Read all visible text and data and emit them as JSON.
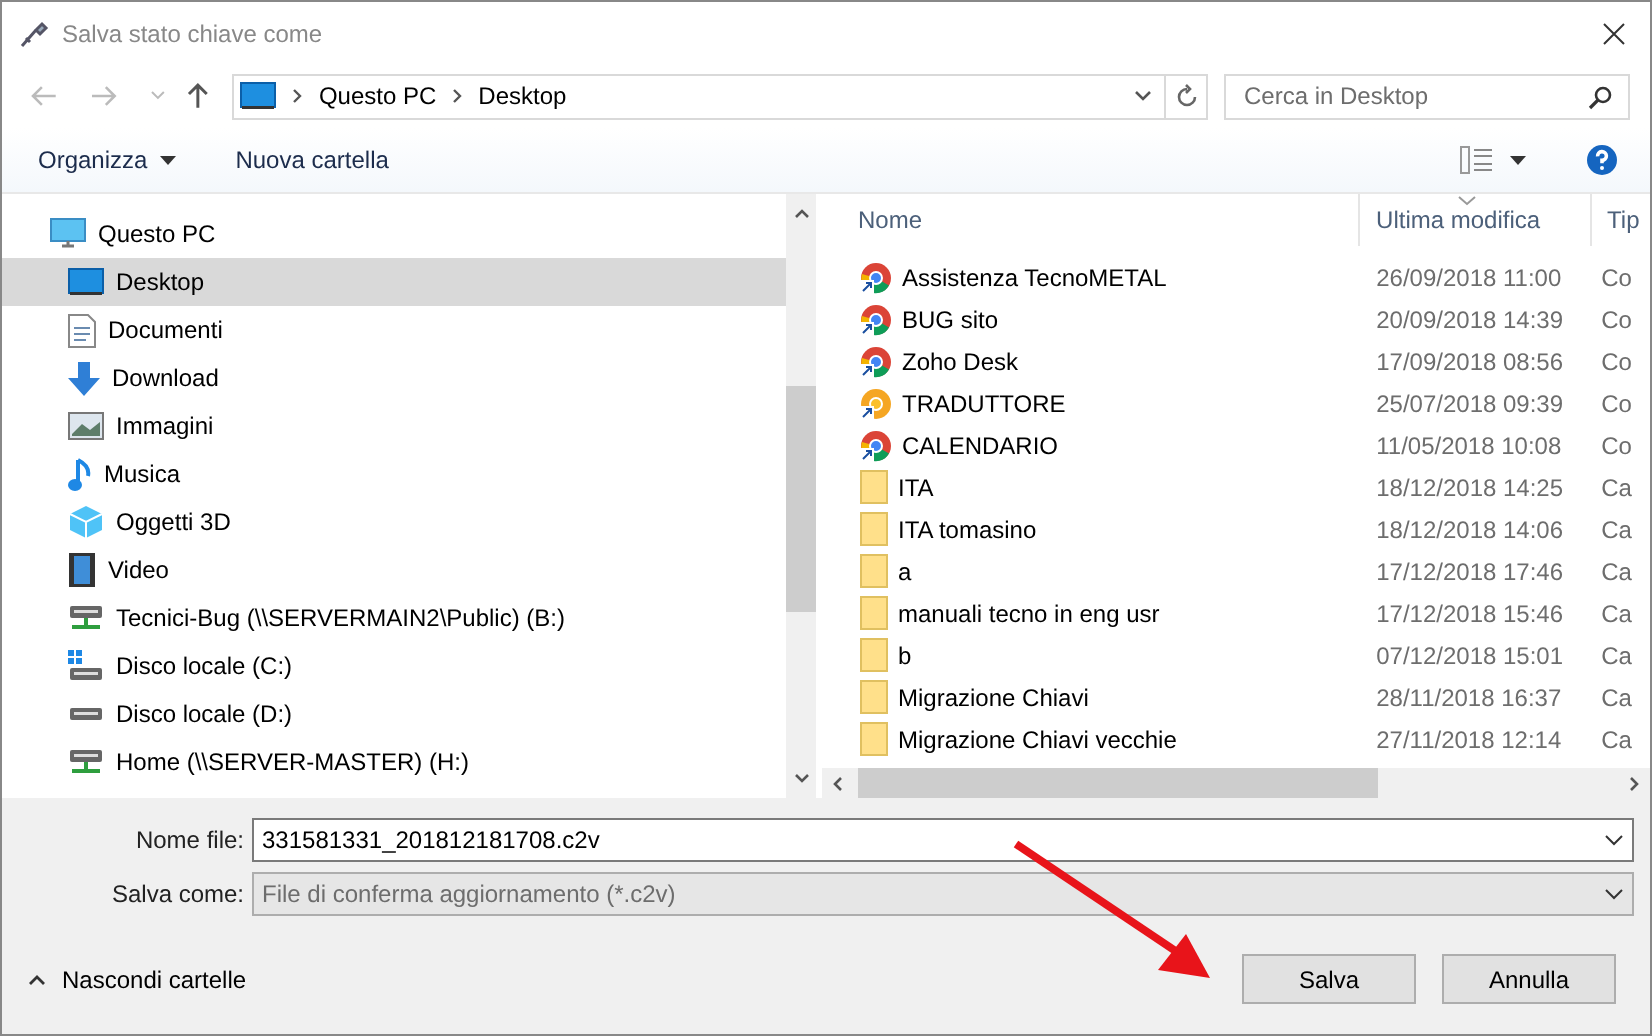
{
  "window": {
    "title": "Salva stato chiave come"
  },
  "address": {
    "crumbs": [
      "Questo PC",
      "Desktop"
    ]
  },
  "search": {
    "placeholder": "Cerca in Desktop"
  },
  "toolbar": {
    "organize": "Organizza",
    "new_folder": "Nuova cartella"
  },
  "sidebar": {
    "items": [
      {
        "label": "Questo PC",
        "kind": "pc",
        "selected": false,
        "children": [
          {
            "label": "Desktop",
            "kind": "desktop",
            "selected": true
          },
          {
            "label": "Documenti",
            "kind": "documents",
            "selected": false
          },
          {
            "label": "Download",
            "kind": "download",
            "selected": false
          },
          {
            "label": "Immagini",
            "kind": "pictures",
            "selected": false
          },
          {
            "label": "Musica",
            "kind": "music",
            "selected": false
          },
          {
            "label": "Oggetti 3D",
            "kind": "objects3d",
            "selected": false
          },
          {
            "label": "Video",
            "kind": "video",
            "selected": false
          },
          {
            "label": "Tecnici-Bug (\\\\SERVERMAIN2\\Public) (B:)",
            "kind": "netdrive",
            "selected": false
          },
          {
            "label": "Disco locale (C:)",
            "kind": "sysdrive",
            "selected": false
          },
          {
            "label": "Disco locale (D:)",
            "kind": "drive",
            "selected": false
          },
          {
            "label": "Home (\\\\SERVER-MASTER) (H:)",
            "kind": "netdrive",
            "selected": false
          }
        ]
      }
    ]
  },
  "table": {
    "columns": [
      "Nome",
      "Ultima modifica",
      "Tip"
    ],
    "rows": [
      {
        "kind": "shortcut",
        "name": "Assistenza TecnoMETAL",
        "modified": "26/09/2018 11:00",
        "column_3": "Co"
      },
      {
        "kind": "shortcut",
        "name": "BUG sito",
        "modified": "20/09/2018 14:39",
        "column_3": "Co"
      },
      {
        "kind": "shortcut",
        "name": "Zoho Desk",
        "modified": "17/09/2018 08:56",
        "column_3": "Co"
      },
      {
        "kind": "shortcut_alt",
        "name": "TRADUTTORE",
        "modified": "25/07/2018 09:39",
        "column_3": "Co"
      },
      {
        "kind": "shortcut",
        "name": "CALENDARIO",
        "modified": "11/05/2018 10:08",
        "column_3": "Co"
      },
      {
        "kind": "folder",
        "name": "ITA",
        "modified": "18/12/2018 14:25",
        "column_3": "Ca"
      },
      {
        "kind": "folder",
        "name": "ITA tomasino",
        "modified": "18/12/2018 14:06",
        "column_3": "Ca"
      },
      {
        "kind": "folder",
        "name": "a",
        "modified": "17/12/2018 17:46",
        "column_3": "Ca"
      },
      {
        "kind": "folder",
        "name": "manuali tecno in eng usr",
        "modified": "17/12/2018 15:46",
        "column_3": "Ca"
      },
      {
        "kind": "folder",
        "name": "b",
        "modified": "07/12/2018 15:01",
        "column_3": "Ca"
      },
      {
        "kind": "folder",
        "name": "Migrazione Chiavi",
        "modified": "28/11/2018 16:37",
        "column_3": "Ca"
      },
      {
        "kind": "folder",
        "name": "Migrazione Chiavi vecchie",
        "modified": "27/11/2018 12:14",
        "column_3": "Ca"
      }
    ]
  },
  "form": {
    "filename_label": "Nome file:",
    "filename": "331581331_201812181708.c2v",
    "type_label": "Salva come:",
    "type": "File di conferma aggiornamento (*.c2v)"
  },
  "footer": {
    "hide_folders": "Nascondi cartelle",
    "buttons": [
      "Salva",
      "Annulla"
    ]
  }
}
